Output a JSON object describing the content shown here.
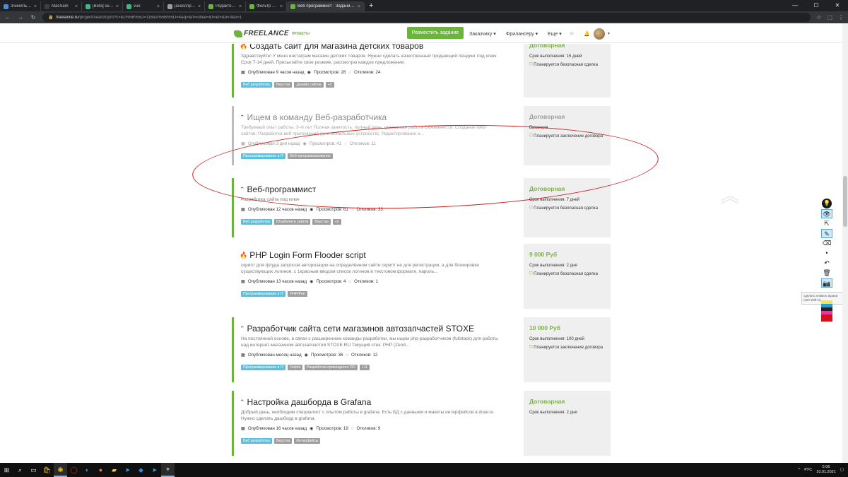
{
  "browser": {
    "tabs": [
      {
        "title": "Зчиняль сн зм...",
        "color": "#4a90d9",
        "active": false
      },
      {
        "title": "MacSam",
        "color": "#3f3f3f",
        "active": false
      },
      {
        "title": "[Beta] server: Задание проекта",
        "color": "#41b883",
        "active": false
      },
      {
        "title": "vue",
        "color": "#41b883",
        "active": false
      },
      {
        "title": "javascript hodight elements - Пом",
        "color": "#9e9e9e",
        "active": false
      },
      {
        "title": "Редактор | Публиканы работы и",
        "color": "#6db33f",
        "active": false
      },
      {
        "title": "Фильтр заданий · Проекты · Vo",
        "color": "#6db33f",
        "active": false
      },
      {
        "title": "Веб программист · Задание до",
        "color": "#6db33f",
        "active": true
      }
    ],
    "new_tab": "+",
    "url_host": "freelance.ru",
    "url_path": "/project/search/pro?c=&c%5B%5D=116&c%5B%5D=4&q=&m=or&e=&f=&t=&o=0&o=1"
  },
  "site": {
    "logo_text": "FREELANCE",
    "logo_sub": "ПРОЕКТЫ",
    "post_button": "Разместить задание",
    "menu": [
      "Заказчику ▾",
      "Фрилансеру ▾",
      "Еще ▾"
    ]
  },
  "projects": [
    {
      "title": "Создать сайт для магазина детских товаров",
      "icon": "flame-icon",
      "desc": "Здравствуйте! У меня инстаграм магазин детских товаров. Нужно сделать качественный продающий лендинг под ключ. Срок 7-14 дней. Присылайте свое резюме, рассмотрю каждое предложение.",
      "published": "Опубликован 9 часов назад",
      "views": "Просмотров: 28",
      "responses": "Откликов: 24",
      "tags": [
        "Веб разработка",
        "Верстка",
        "Дизайн сайтов",
        "+2"
      ],
      "price": "Договорная",
      "term": "Срок выполнения: 15 дней",
      "safe": "Планируется безопасная сделка"
    },
    {
      "title": "Ищем в команду Веб-разработчика",
      "icon": "chevron-up-icon",
      "desc": "Требуемый опыт работы: 3–6 лет Полная занятость, полный день, удаленная работа Обязанности: Создание web-сайтов; Разработка веб приложений (для мобильных устройств); Редактирование и...",
      "published": "Опубликован 3 дня назад",
      "views": "Просмотров: 41",
      "responses": "Откликов: 11",
      "tags": [
        "Программирование в IT",
        "Веб-программирование"
      ],
      "price": "Договорная",
      "term": "Вакансия",
      "safe": "Планируется заключение договора"
    },
    {
      "title": "Веб-программист",
      "icon": "chevron-up-icon",
      "desc": "Разработка сайта под ключ",
      "published": "Опубликован 12 часов назад",
      "views": "Просмотров: 61",
      "responses": "Откликов: 33",
      "tags": [
        "Веб разработка",
        "Юзабилити сайтов",
        "Верстка",
        "+2"
      ],
      "price": "Договорная",
      "term": "Срок выполнения: 7 дней",
      "safe": "Планируется безопасная сделка"
    },
    {
      "title": "PHP Login Form Flooder script",
      "icon": "flame-icon",
      "desc": "скрипт для флуда запросов авторизации на определённом сайте скрипт не для регистрации, а для блокировки существующих логинов, с 1красным вводом список логинов в текстовом формате, пароль...",
      "published": "Опубликован 13 часов назад",
      "views": "Просмотров: 4",
      "responses": "Откликов: 1",
      "tags": [
        "Программирование в IT",
        "PHP/Perl"
      ],
      "price": "9 000 Руб",
      "term": "Срок выполнения: 2 дня",
      "safe": "Планируется безопасная сделка"
    },
    {
      "title": "Разработчик сайта сети магазинов автозапчастей STOXE",
      "icon": "chevron-up-icon",
      "desc": "На постоянной основе, в связи с расширением команды разработки, мы ищем php-разработчиков (fullstack) для работы над интернет-магазином автозапчастей STOXE.RU Текущий стек: PHP (Zend...",
      "published": "Опубликован месяц назад",
      "views": "Просмотров: 36",
      "responses": "Откликов: 12",
      "tags": [
        "Программирование в IT",
        "Delphi",
        "Разработка прикладного ПО",
        "+11"
      ],
      "price": "10 000 Руб",
      "term": "Срок выполнения: 100 дней",
      "safe": "Планируется заключение договора"
    },
    {
      "title": "Настройка дашборда в Grafana",
      "icon": "chevron-up-icon",
      "desc": "Добрый день, необходим специалист с опытом работы в grafana. Есть БД с данными и макеты интерфейсов в draw.io. Нужно сделать дашборд в grafana.",
      "published": "Опубликован 16 часов назад",
      "views": "Просмотров: 19",
      "responses": "Откликов: 9",
      "tags": [
        "Веб разработка",
        "Верстка",
        "Интерфейсы"
      ],
      "price": "Договорная",
      "term": "Срок выполнения: 2 дня",
      "safe": ""
    }
  ],
  "annotation_tooltip": "сделать снимок экрана (ctrl+shift+s)",
  "taskbar": {
    "lang": "РУС",
    "time": "5:06",
    "date": "10.01.2021"
  }
}
